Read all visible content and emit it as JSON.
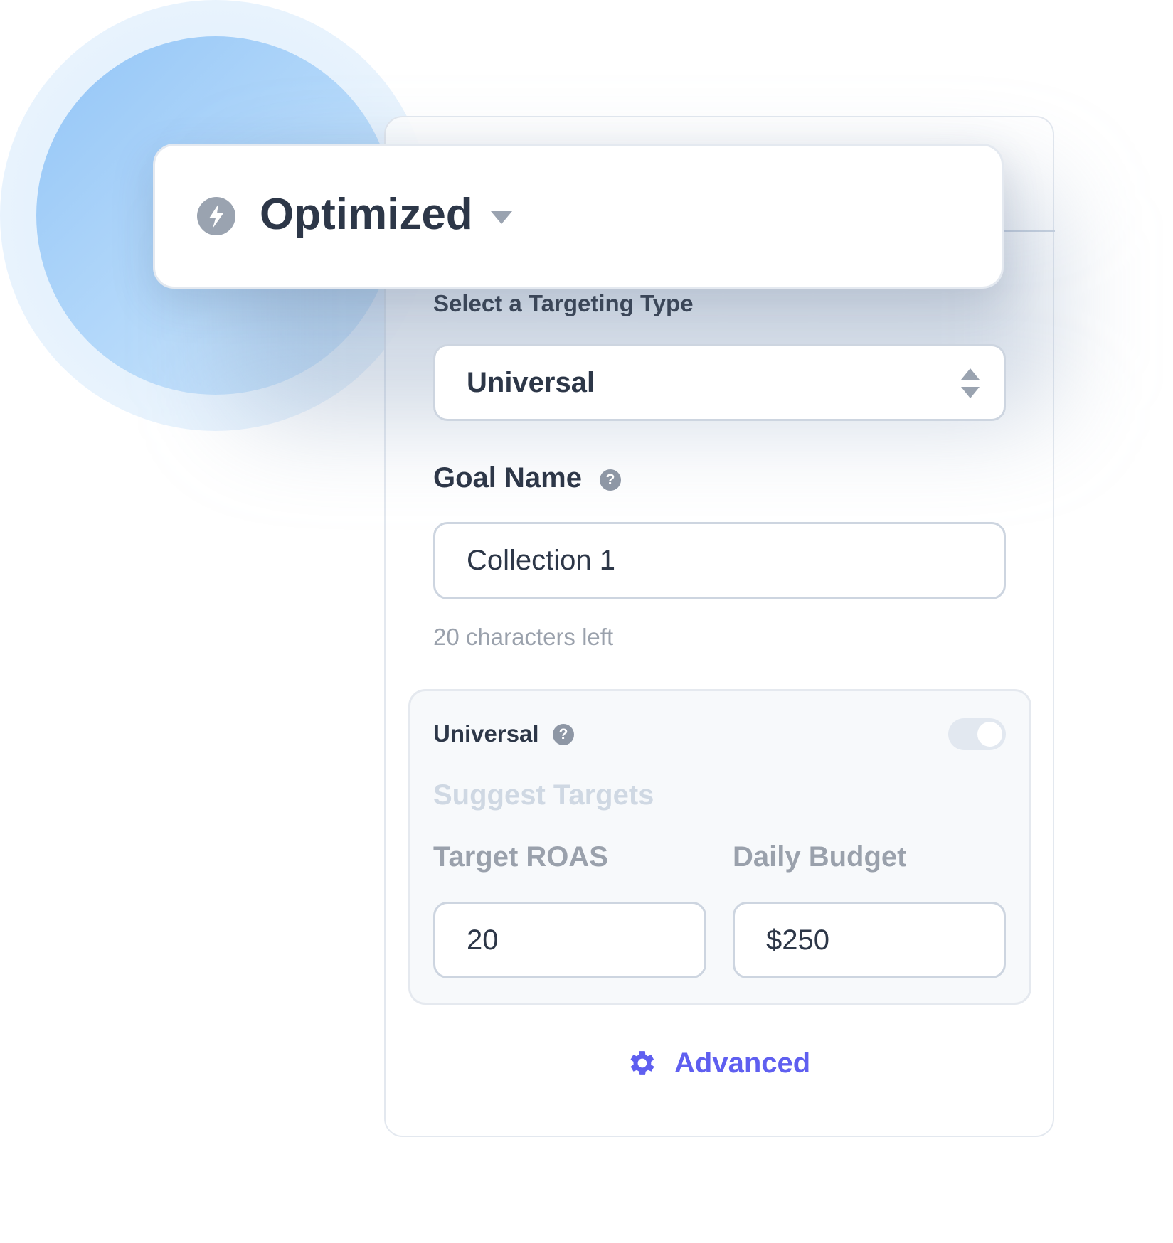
{
  "mode_selector": {
    "icon": "lightning-bolt-icon",
    "label": "Optimized"
  },
  "targeting": {
    "label": "Select a Targeting Type",
    "value": "Universal"
  },
  "goal_name": {
    "label": "Goal Name",
    "value": "Collection 1",
    "hint": "20 characters left"
  },
  "universal_panel": {
    "title": "Universal",
    "toggle_on": false,
    "suggest_label": "Suggest Targets",
    "target_roas": {
      "label": "Target ROAS",
      "value": "20"
    },
    "daily_budget": {
      "label": "Daily Budget",
      "value": "$250"
    }
  },
  "advanced": {
    "label": "Advanced",
    "icon": "gear-icon"
  },
  "colors": {
    "accent": "#5f5ff0",
    "text": "#2d3748",
    "muted": "#9aa1ac"
  }
}
